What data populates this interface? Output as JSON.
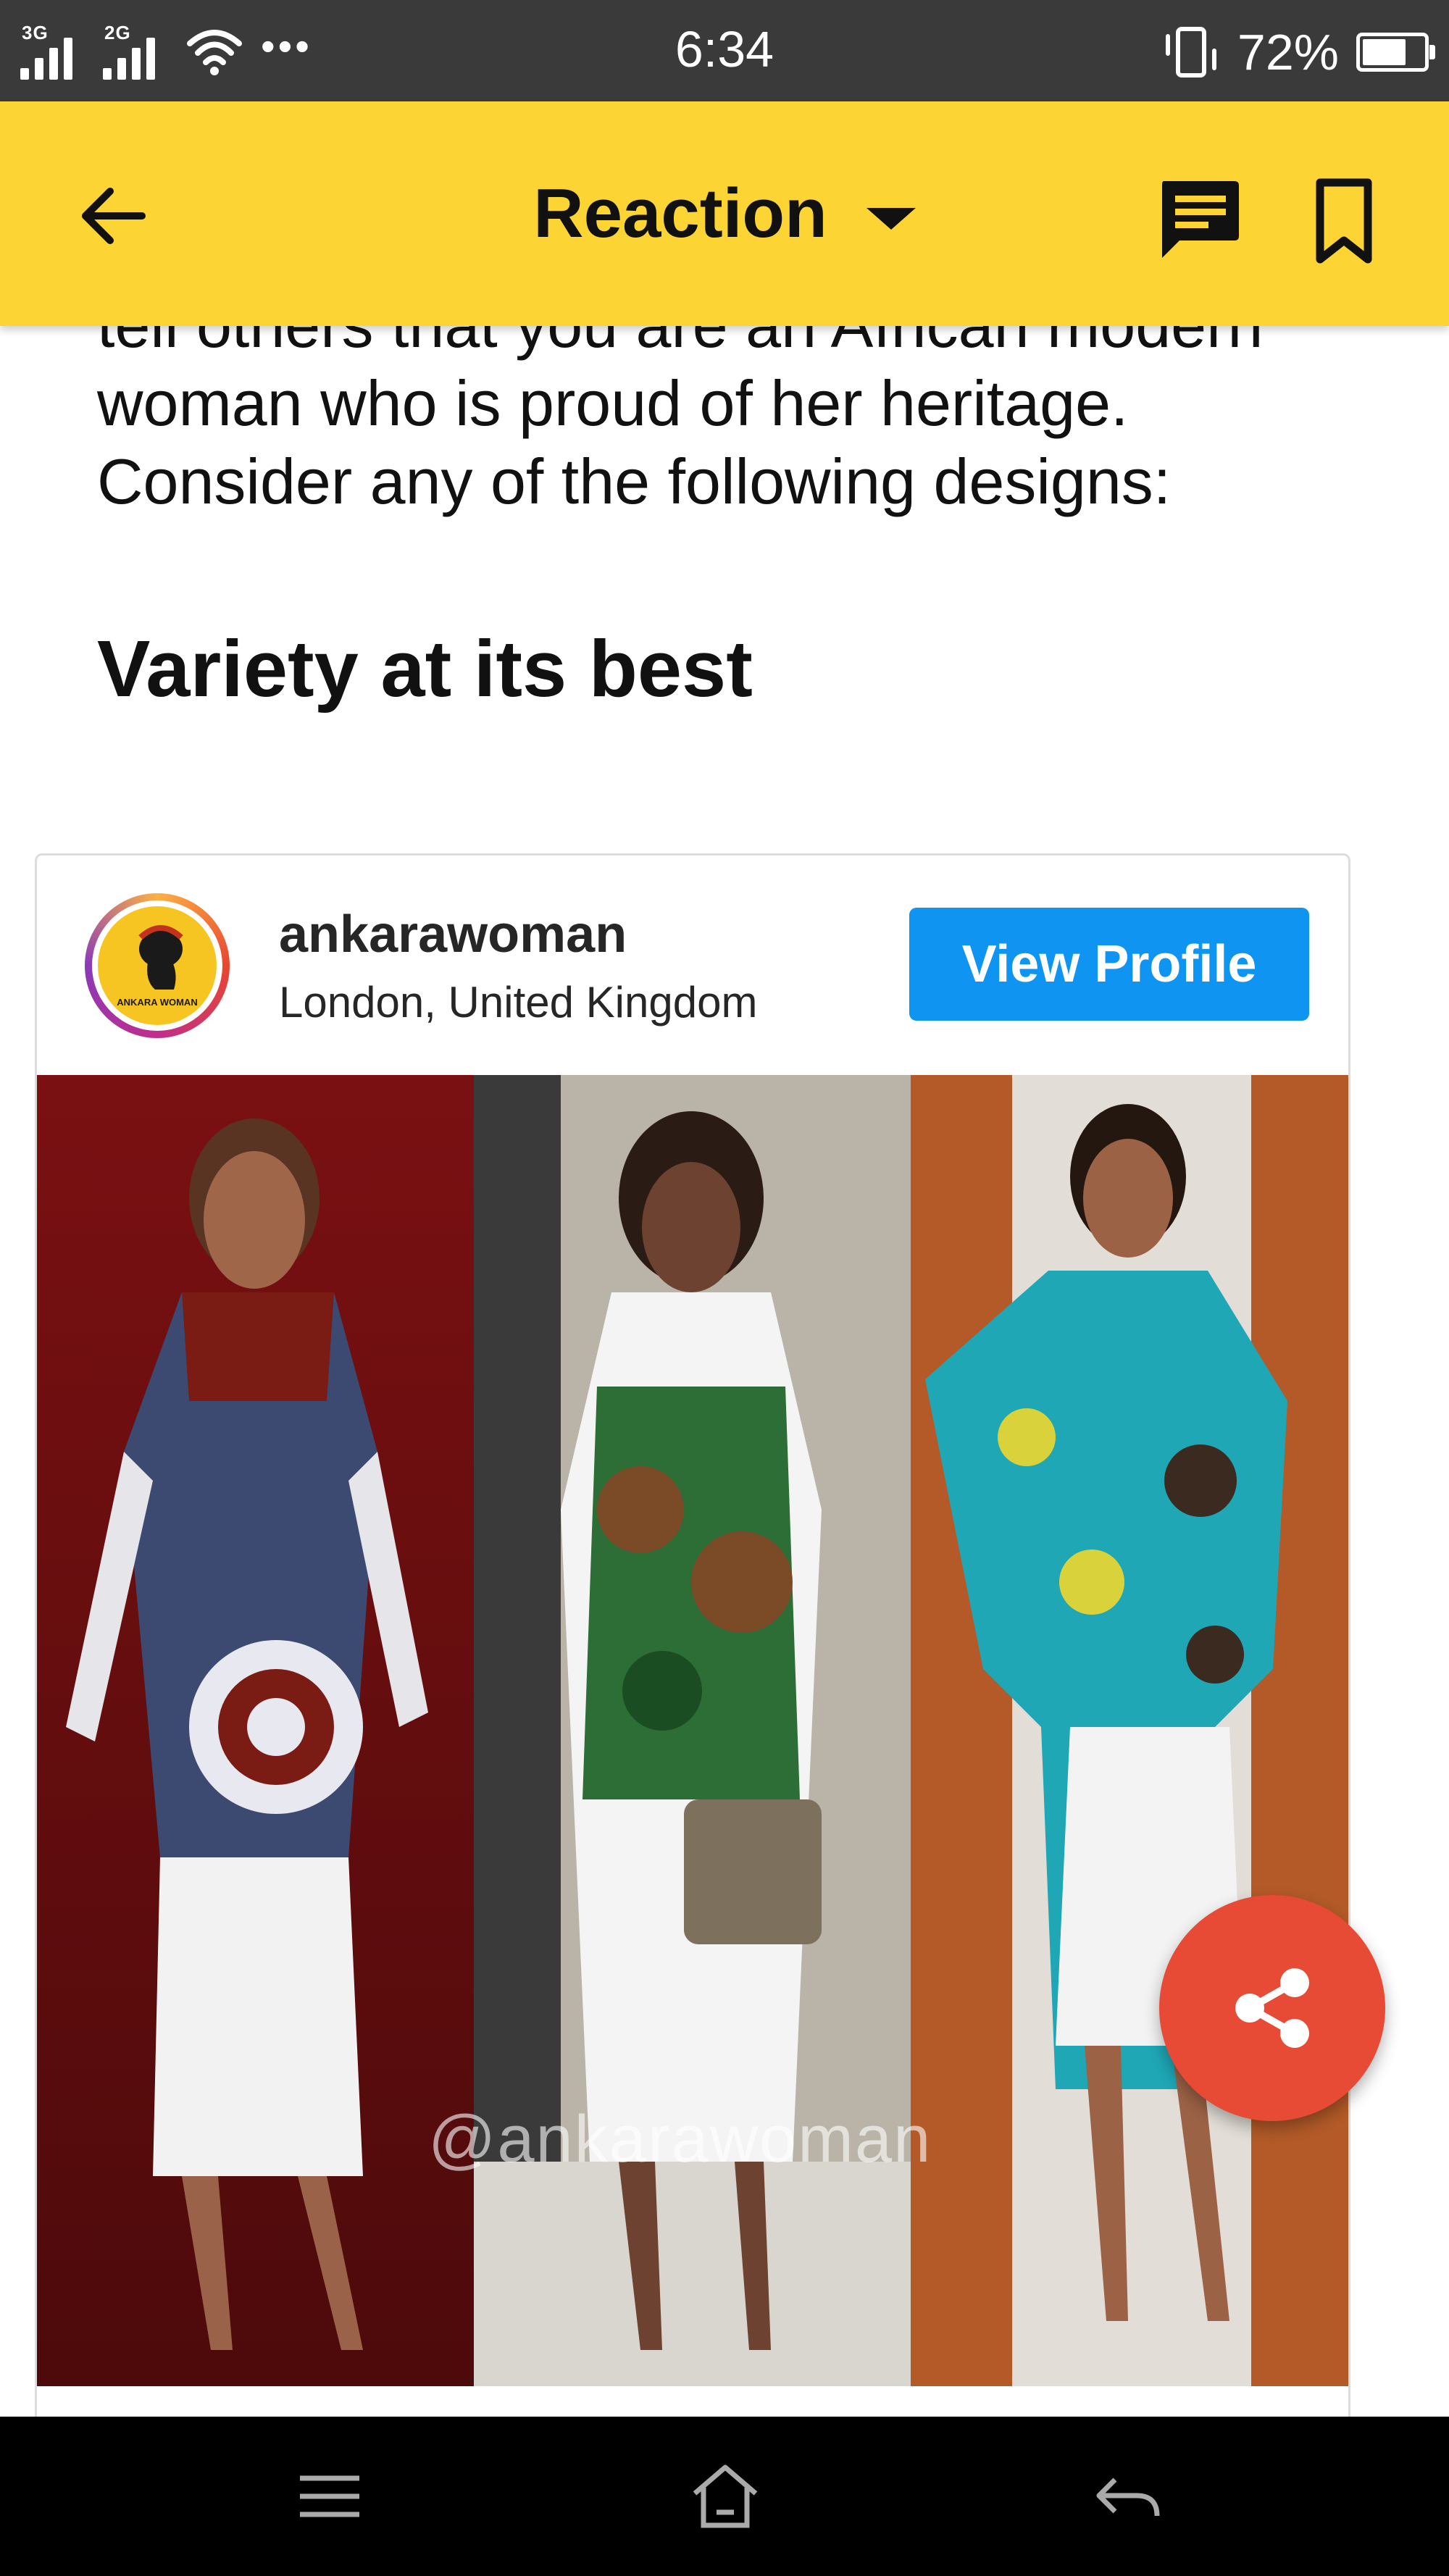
{
  "status_bar": {
    "network_1": "3G",
    "network_2": "2G",
    "overflow": "•••",
    "time": "6:34",
    "battery_percent": "72%",
    "battery_level": 0.72,
    "icons": [
      "signal-icon",
      "wifi-icon",
      "vibrate-icon",
      "battery-icon"
    ]
  },
  "header": {
    "title": "Reaction",
    "background": "#fcd535",
    "icons": [
      "back-arrow-icon",
      "dropdown-caret-icon",
      "comment-icon",
      "bookmark-icon"
    ]
  },
  "article": {
    "line_1": "tell others that you are an African modern",
    "line_2": "woman who is proud of her heritage.",
    "line_3": "Consider any of the following designs:",
    "section_heading": "Variety at its best"
  },
  "embed": {
    "username": "ankarawoman",
    "location": "London, United Kingdom",
    "view_profile_label": "View Profile",
    "view_profile_color": "#0f95f1",
    "watermark": "@ankarawoman",
    "avatar_text": "ANKARA WOMAN"
  },
  "fab": {
    "icon": "share-icon",
    "color": "#e74b35"
  },
  "nav_bar": {
    "icons": [
      "menu-icon",
      "home-icon",
      "back-icon"
    ]
  }
}
